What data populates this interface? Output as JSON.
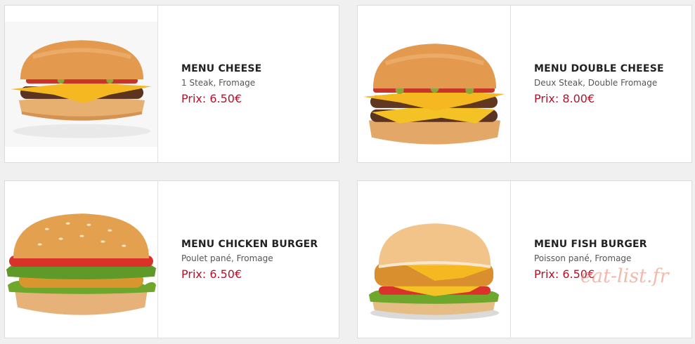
{
  "menu_items": [
    {
      "title": "MENU CHEESE",
      "description": "1 Steak, Fromage",
      "price": "Prix: 6.50€",
      "image_icon": "cheeseburger-image"
    },
    {
      "title": "MENU DOUBLE CHEESE",
      "description": "Deux Steak, Double Fromage",
      "price": "Prix: 8.00€",
      "image_icon": "double-cheeseburger-image"
    },
    {
      "title": "MENU CHICKEN BURGER",
      "description": "Poulet pané, Fromage",
      "price": "Prix: 6.50€",
      "image_icon": "chicken-burger-image"
    },
    {
      "title": "MENU FISH BURGER",
      "description": "Poisson pané, Fromage",
      "price": "Prix: 6.50€",
      "image_icon": "fish-burger-image"
    }
  ],
  "watermark": "eat-list.fr",
  "colors": {
    "price": "#b3122b",
    "background": "#f0f0f0",
    "card": "#ffffff"
  }
}
